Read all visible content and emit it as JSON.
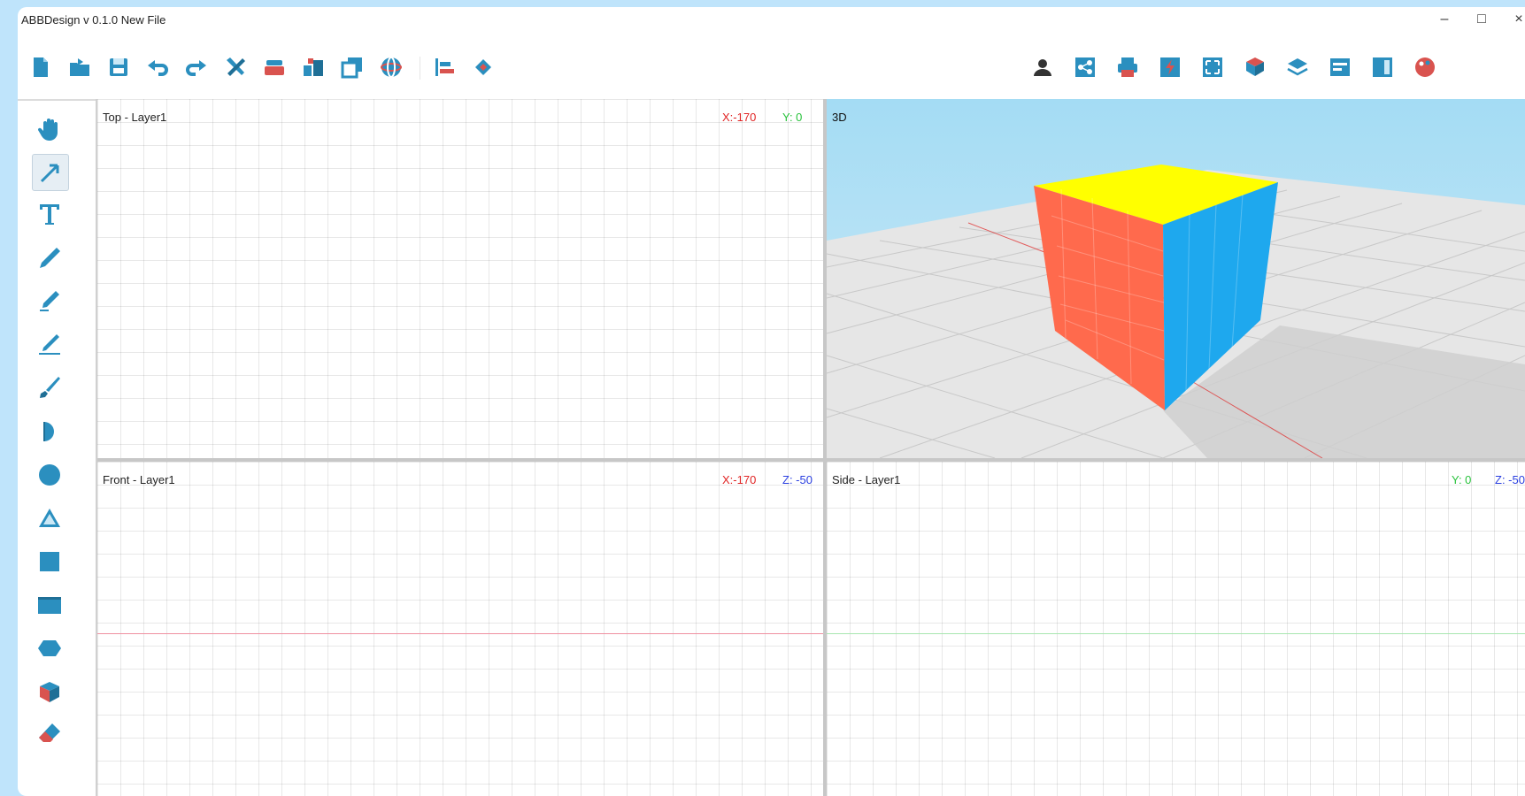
{
  "app": {
    "title": "ABBDesign v 0.1.0   New File",
    "window_controls": {
      "minimize": "–",
      "maximize": "□",
      "close": "×"
    }
  },
  "toolbar": {
    "left_icons": [
      "new-file-icon",
      "open-file-icon",
      "save-icon",
      "undo-icon",
      "redo-icon",
      "tools-icon",
      "stamp-icon",
      "stack-icon",
      "copy-shape-icon",
      "globe-icon",
      "align-icon",
      "diamond-nodes-icon"
    ],
    "right_icons": [
      "user-icon",
      "share-icon",
      "print-icon",
      "flash-icon",
      "fit-view-icon",
      "shape-fill-icon",
      "layers-icon",
      "settings-panel-icon",
      "split-view-icon",
      "palette-icon"
    ]
  },
  "tools": {
    "items": [
      "hand-tool-icon",
      "select-arrow-icon",
      "text-tool-icon",
      "pen-tool-icon",
      "pencil-tool-icon",
      "line-tool-icon",
      "brush-tool-icon",
      "half-circle-icon",
      "circle-tool-icon",
      "triangle-tool-icon",
      "square-tool-icon",
      "rectangle-tool-icon",
      "ellipse-tool-icon",
      "box-3d-icon",
      "eraser-icon"
    ],
    "active": "select-arrow-icon"
  },
  "viewports": {
    "top": {
      "label": "Top - Layer1",
      "x": "X:-170",
      "y": "Y: 0"
    },
    "view3d": {
      "label": "3D"
    },
    "front": {
      "label": "Front - Layer1",
      "x": "X:-170",
      "z": "Z: -50"
    },
    "side": {
      "label": "Side - Layer1",
      "y": "Y: 0",
      "z": "Z: -50"
    }
  },
  "colors": {
    "accent": "#2b8fbf",
    "x_axis": "#e02424",
    "y_axis": "#28c23c",
    "z_axis": "#2a3fe0",
    "cube_top": "#ffff00",
    "cube_left": "#ff6a4d",
    "cube_right": "#1ea8ee",
    "sky": "#b8e2f6"
  }
}
